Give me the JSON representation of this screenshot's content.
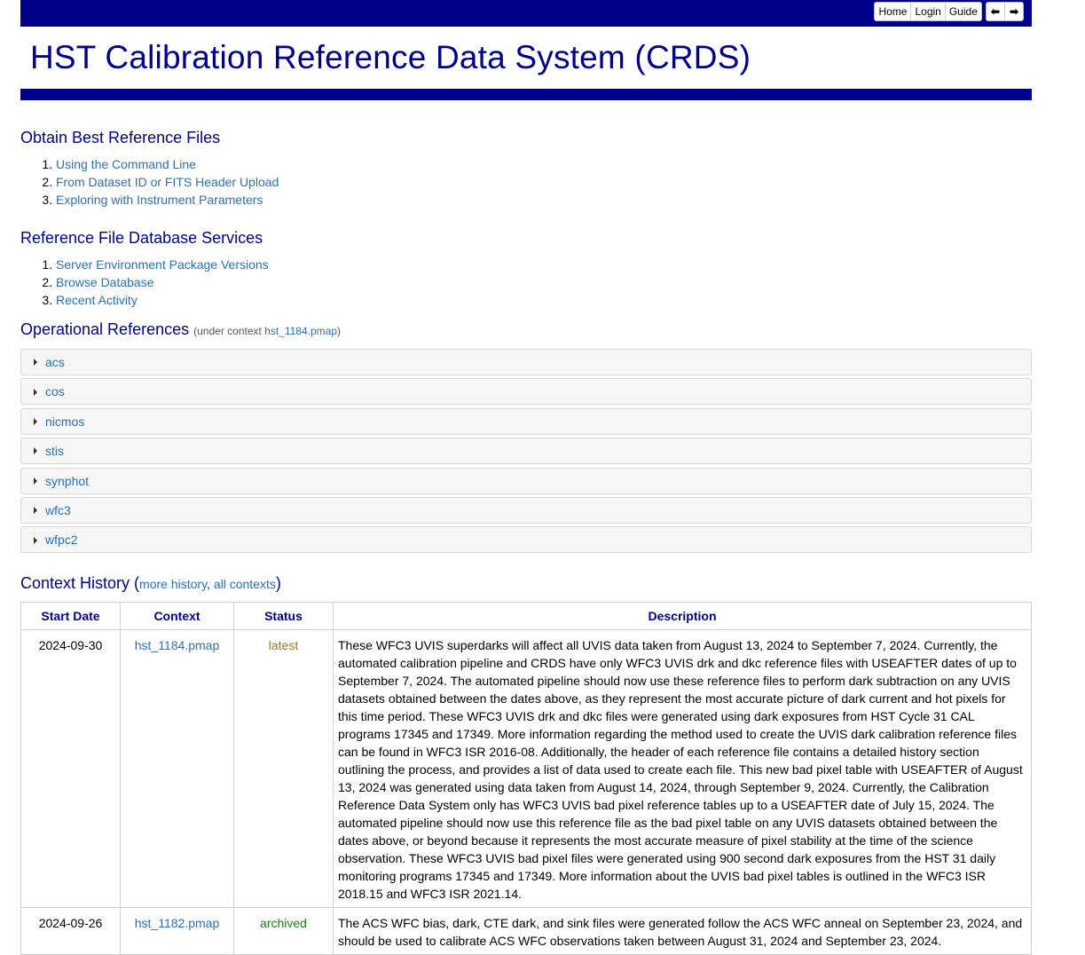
{
  "nav": {
    "buttons": [
      "Home",
      "Login",
      "Guide"
    ],
    "arrows": [
      "⬅",
      "➡"
    ]
  },
  "page_title": "HST Calibration Reference Data System (CRDS)",
  "obtain": {
    "heading": "Obtain Best Reference Files",
    "items": [
      "Using the Command Line",
      "From Dataset ID or FITS Header Upload",
      "Exploring with Instrument Parameters"
    ]
  },
  "db_services": {
    "heading": "Reference File Database Services",
    "items": [
      "Server Environment Package Versions",
      "Browse Database",
      "Recent Activity"
    ]
  },
  "operational": {
    "heading": "Operational References",
    "note_prefix": "(under context ",
    "context_link": "hst_1184.pmap",
    "note_suffix": ")",
    "instruments": [
      "acs",
      "cos",
      "nicmos",
      "stis",
      "synphot",
      "wfc3",
      "wfpc2"
    ]
  },
  "context_history": {
    "heading": "Context History",
    "paren_open": " (",
    "more_history": "more history",
    "comma": ", ",
    "all_contexts": "all contexts",
    "paren_close": ")",
    "columns": [
      "Start Date",
      "Context",
      "Status",
      "Description"
    ],
    "rows": [
      {
        "start_date": "2024-09-30",
        "context": "hst_1184.pmap",
        "status": "latest",
        "description": "These WFC3 UVIS superdarks will affect all UVIS data taken from August 13, 2024 to September 7, 2024. Currently, the automated calibration pipeline and CRDS have only WFC3 UVIS drk and dkc reference files with USEAFTER dates of up to September 7, 2024. The automated pipeline should now use these reference files to perform dark subtraction on any UVIS datasets obtained between the dates above, as they represent the most accurate picture of dark current and hot pixels for this time period. These WFC3 UVIS drk and dkc files were generated using dark exposures from HST Cycle 31 CAL programs 17345 and 17349. More information regarding the method used to create the UVIS dark calibration reference files can be found in WFC3 ISR 2016-08. Additionally, the header of each reference file contains a detailed history section outlining the process, and provides a list of data used to create each file. This new bad pixel table with USEAFTER of August 13, 2024 was generated using data taken from August 14, 2024, through September 9, 2024. Currently, the Calibration Reference Data System only has WFC3 UVIS bad pixel reference tables up to a USEAFTER date of July 15, 2024. The automated pipeline should now use this reference file as the bad pixel table on any UVIS datasets obtained between the dates above, or beyond because it represents the most accurate measure of pixel stability at the time of the science observation. These WFC3 UVIS bad pixel files were generated using 900 second dark exposures from the HST 31 daily monitoring programs 17345 and 17349. More information about the UVIS bad pixel tables is outlined in the WFC3 ISR 2018.15 and WFC3 ISR 2021.14."
      },
      {
        "start_date": "2024-09-26",
        "context": "hst_1182.pmap",
        "status": "archived",
        "description": "The ACS WFC bias, dark, CTE dark, and sink files were generated follow the ACS WFC anneal on September 23, 2024, and should be used to calibrate ACS WFC observations taken between August 31, 2024 and September 23, 2024."
      }
    ]
  },
  "colors": {
    "header_blue": "#00008b",
    "link_blue": "#2a70b8",
    "status_latest": "#9a7a20",
    "status_archived": "#1a7a1a"
  }
}
